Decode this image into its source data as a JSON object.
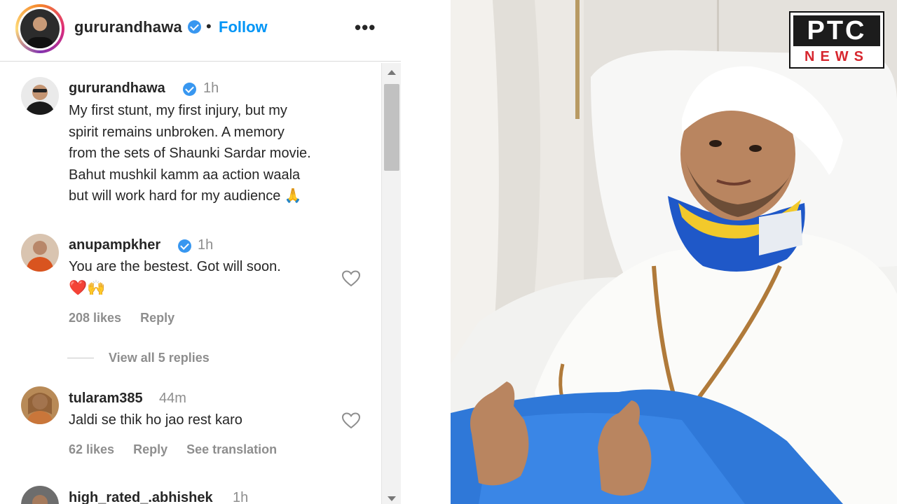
{
  "post": {
    "header_username": "gururandhawa",
    "separator": "•",
    "follow_label": "Follow",
    "more_label": "•••"
  },
  "comments": [
    {
      "username": "gururandhawa",
      "time": "1h",
      "verified": true,
      "lines": [
        "My first stunt, my first injury, but my",
        "spirit remains unbroken. A memory",
        "from the sets of Shaunki Sardar movie.",
        "Bahut mushkil kamm aa action waala",
        "but will work hard for my audience 🙏"
      ]
    },
    {
      "username": "anupampkher",
      "time": "1h",
      "verified": true,
      "lines": [
        "You are the bestest. Got will soon.",
        "❤️🙌"
      ],
      "likes": "208 likes",
      "reply_label": "Reply",
      "view_replies": "View all 5 replies"
    },
    {
      "username": "tularam385",
      "time": "44m",
      "verified": false,
      "lines": [
        "Jaldi se thik ho jao rest karo"
      ],
      "likes": "62 likes",
      "reply_label": "Reply",
      "translation_label": "See translation"
    },
    {
      "username": "high_rated_.abhishek",
      "time": "1h",
      "verified": false
    }
  ],
  "logo": {
    "top": "PTC",
    "bottom": "NEWS",
    "colors": {
      "top_bg": "#1c1c1c",
      "bottom_text": "#d7262e"
    }
  },
  "colors": {
    "link": "#0095f6",
    "verified": "#3897f0",
    "muted": "#8e8e8e"
  }
}
